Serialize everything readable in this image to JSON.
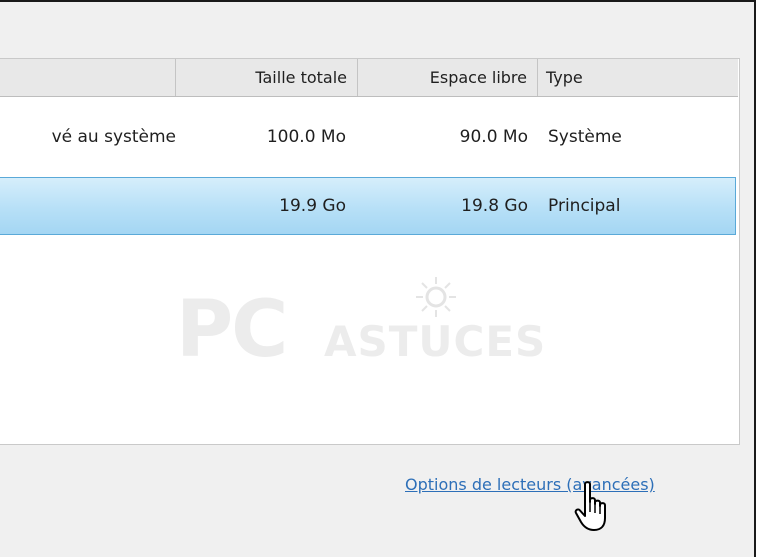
{
  "table": {
    "columns": [
      "",
      "Taille totale",
      "Espace libre",
      "Type"
    ],
    "rows": [
      {
        "name": "vé au système",
        "total": "100.0 Mo",
        "free": "90.0 Mo",
        "type": "Système"
      },
      {
        "name": "",
        "total": "19.9 Go",
        "free": "19.8 Go",
        "type": "Principal"
      }
    ]
  },
  "watermark": {
    "brand_main": "PC",
    "brand_sub": "ASTUCES"
  },
  "link": {
    "label": "Options de lecteurs (avancées)"
  },
  "colors": {
    "selection": "#b7e0f7",
    "link": "#2d6fb8"
  },
  "icons": {
    "cursor": "hand-pointer-icon"
  }
}
